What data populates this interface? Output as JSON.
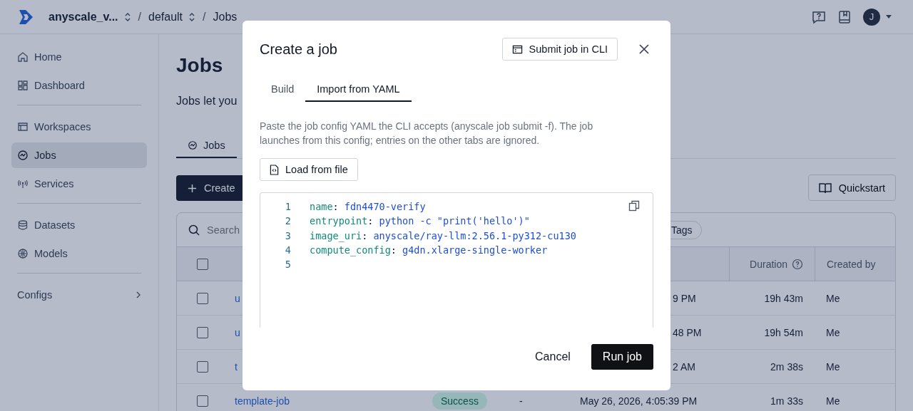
{
  "topbar": {
    "crumbs": [
      {
        "kind": "crumb",
        "label": "anyscale_v...",
        "switcher": true
      },
      {
        "kind": "sep",
        "label": "/"
      },
      {
        "kind": "crumb",
        "label": "default",
        "switcher": true
      },
      {
        "kind": "sep",
        "label": "/"
      },
      {
        "kind": "crumb",
        "label": "Jobs",
        "switcher": false
      }
    ],
    "avatar": "J"
  },
  "sidebar": {
    "groups": [
      [
        {
          "label": "Home",
          "selected": false
        },
        {
          "label": "Dashboard",
          "selected": false
        }
      ],
      [
        {
          "label": "Workspaces",
          "selected": false
        },
        {
          "label": "Jobs",
          "selected": true
        },
        {
          "label": "Services",
          "selected": false
        }
      ],
      [
        {
          "label": "Datasets",
          "selected": false
        },
        {
          "label": "Models",
          "selected": false
        }
      ]
    ],
    "configs": {
      "label": "Configs",
      "expanded": false
    }
  },
  "page": {
    "title": "Jobs",
    "description": "Jobs let you",
    "tabs": [
      {
        "label": "Jobs",
        "selected": true
      }
    ],
    "create_button": "Create",
    "quickstart_button": "Quickstart",
    "table": {
      "search_placeholder": "Search",
      "tags_filter": "Tags",
      "select_all_checked": false,
      "columns": [
        {
          "label": "Duration",
          "help": true
        },
        {
          "label": "Created by",
          "help": false
        }
      ],
      "rows": [
        {
          "checked": false,
          "name": "u",
          "created": "9 PM",
          "duration": "19h 43m",
          "created_by": "Me"
        },
        {
          "checked": false,
          "name": "u",
          "created": "48 PM",
          "duration": "19h 54m",
          "created_by": "Me"
        },
        {
          "checked": false,
          "name": "t",
          "created": "2 AM",
          "duration": "2m 38s",
          "created_by": "Me"
        },
        {
          "checked": false,
          "name": "template-job",
          "status": "Success",
          "column_3": "-",
          "created": "May 26, 2026, 4:05:39 PM",
          "duration": "1m 33s",
          "created_by": "Me"
        }
      ]
    }
  },
  "modal": {
    "title": "Create a job",
    "cli_button": "Submit job in CLI",
    "tabs": [
      {
        "label": "Build",
        "selected": false
      },
      {
        "label": "Import from YAML",
        "selected": true
      }
    ],
    "description": "Paste the job config YAML the CLI accepts (anyscale job submit -f). The job launches from this config; entries on the other tabs are ignored.",
    "load_button": "Load from file",
    "code_lines": [
      {
        "number": "1",
        "key": "name",
        "colon": ":",
        "value": "fdn4470-verify"
      },
      {
        "number": "2",
        "key": "entrypoint",
        "colon": ":",
        "value": "python -c \"print('hello')\""
      },
      {
        "number": "3",
        "key": "image_uri",
        "colon": ":",
        "value": "anyscale/ray-llm:2.56.1-py312-cu130"
      },
      {
        "number": "4",
        "key": "compute_config",
        "colon": ":",
        "value": "g4dn.xlarge-single-worker"
      },
      {
        "number": "5"
      }
    ],
    "cancel_button": "Cancel",
    "run_button": "Run job"
  }
}
